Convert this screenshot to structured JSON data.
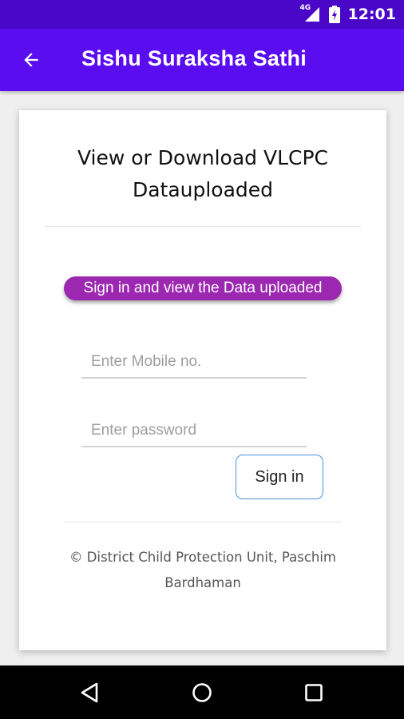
{
  "status_bar": {
    "network": "4G",
    "time": "12:01",
    "icons": [
      "signal-icon",
      "battery-icon"
    ]
  },
  "app_bar": {
    "title": "Sishu Suraksha Sathi",
    "back_icon": "arrow-back-icon"
  },
  "card": {
    "title": "View or Download VLCPC Datauploaded",
    "badge": "Sign in and view the Data uploaded",
    "mobile_placeholder": "Enter Mobile no.",
    "password_placeholder": "Enter password",
    "signin_label": "Sign in",
    "footer": "© District Child Protection Unit, Paschim Bardhaman"
  },
  "nav_bar": {
    "icons": [
      "back-triangle-icon",
      "home-circle-icon",
      "recents-square-icon"
    ]
  },
  "colors": {
    "status_bar": "#4a07c8",
    "app_bar": "#5a0ef0",
    "badge": "#9c27b0",
    "button_border": "#4a90e2"
  }
}
